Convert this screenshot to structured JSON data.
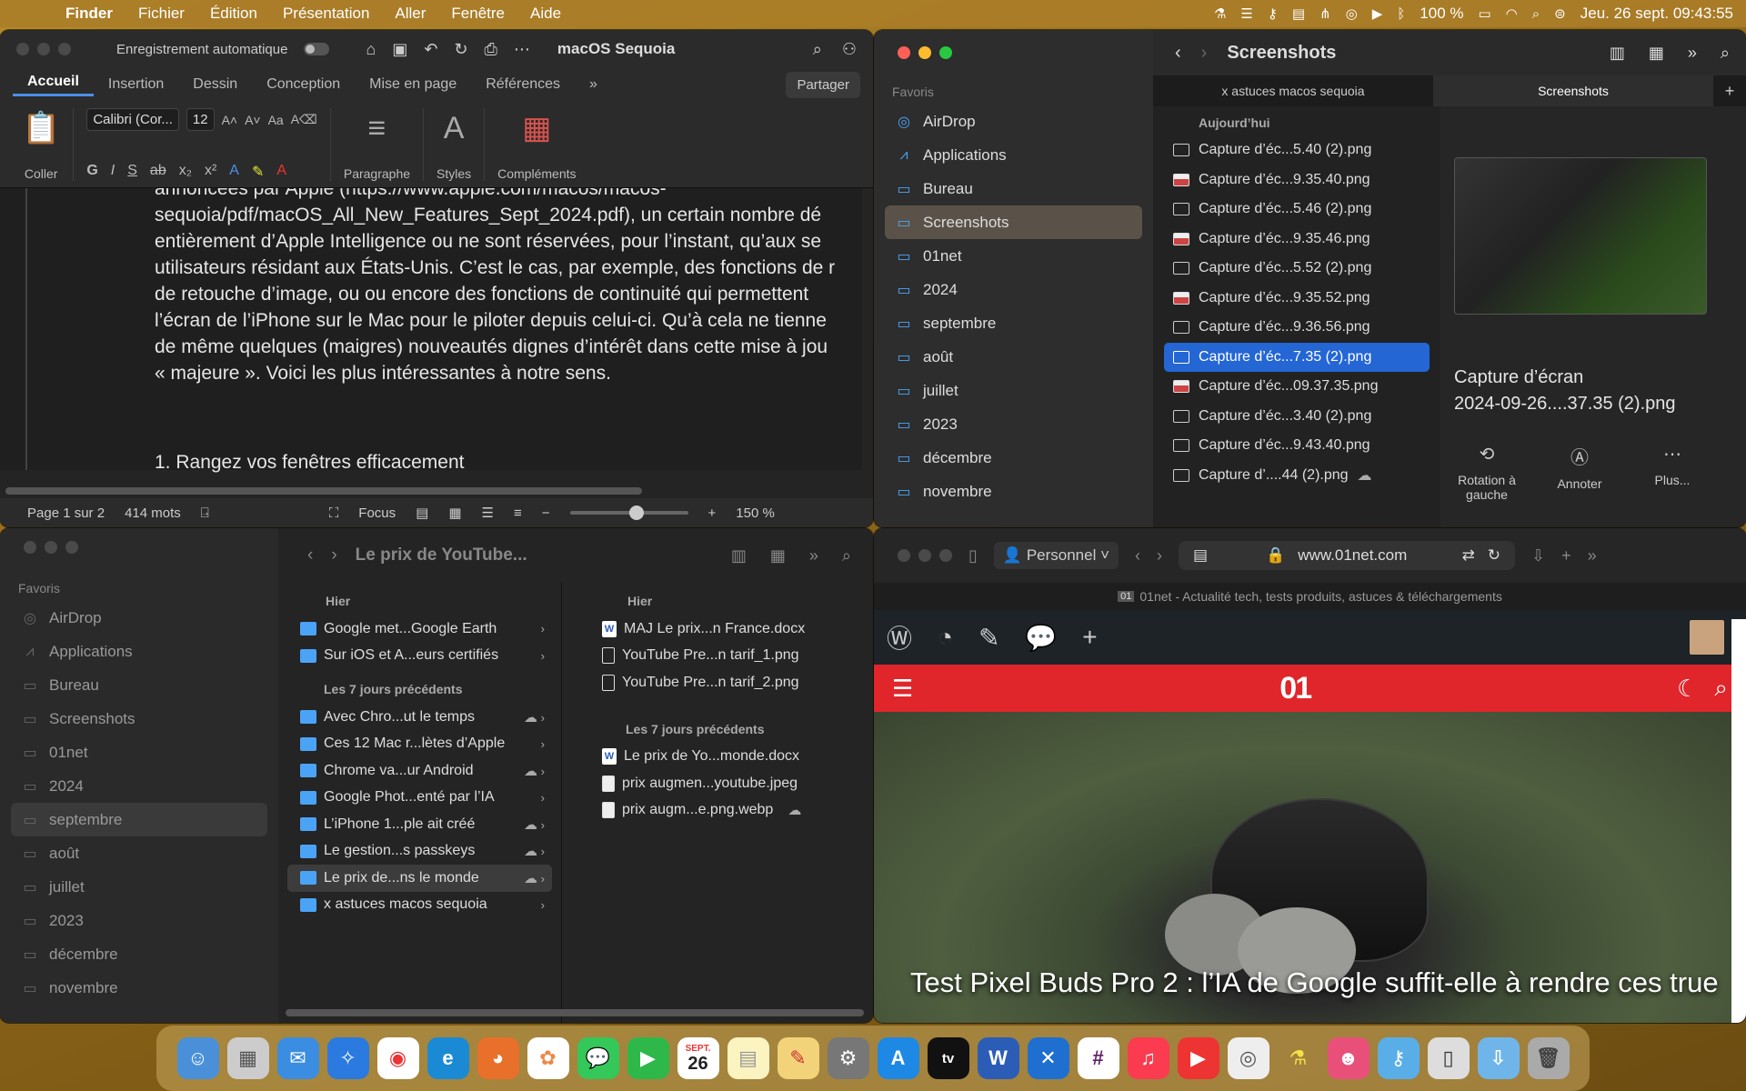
{
  "menubar": {
    "app": "Finder",
    "menus": [
      "Fichier",
      "Édition",
      "Présentation",
      "Aller",
      "Fenêtre",
      "Aide"
    ],
    "battery": "100 %",
    "datetime": "Jeu. 26 sept.  09:43:55"
  },
  "word": {
    "autosave": "Enregistrement automatique",
    "doc_title": "macOS Sequoia",
    "tabs": [
      "Accueil",
      "Insertion",
      "Dessin",
      "Conception",
      "Mise en page",
      "Références"
    ],
    "share": "Partager",
    "paste_label": "Coller",
    "font_name": "Calibri (Cor...",
    "font_size": "12",
    "paragraph_label": "Paragraphe",
    "styles_label": "Styles",
    "addins_label": "Compléments",
    "body_lines": [
      "annoncées par Apple (https://www.apple.com/macos/macos-",
      "sequoia/pdf/macOS_All_New_Features_Sept_2024.pdf), un certain nombre dé",
      "entièrement d’Apple Intelligence ou ne sont réservées, pour l’instant, qu’aux se",
      "utilisateurs résidant aux États-Unis. C’est le cas, par exemple, des fonctions de r",
      "de retouche d’image, ou ou encore des fonctions de continuité qui permettent",
      "l’écran de l’iPhone sur le Mac pour le piloter depuis celui-ci. Qu’à cela ne tienne",
      "de même quelques (maigres) nouveautés dignes d’intérêt dans cette mise à jou",
      "« majeure ». Voici les plus intéressantes à notre sens."
    ],
    "heading": "1. Rangez vos fenêtres efficacement",
    "status": {
      "page": "Page 1 sur 2",
      "words": "414 mots",
      "focus": "Focus",
      "zoom": "150 %"
    }
  },
  "finder_top": {
    "title": "Screenshots",
    "sidebar_section": "Favoris",
    "sidebar": [
      "AirDrop",
      "Applications",
      "Bureau",
      "Screenshots",
      "01net",
      "2024",
      "septembre",
      "août",
      "juillet",
      "2023",
      "décembre",
      "novembre"
    ],
    "tabs": [
      "x astuces macos sequoia",
      "Screenshots"
    ],
    "group": "Aujourd’hui",
    "files": [
      "Capture d’éc...5.40 (2).png",
      "Capture d’éc...9.35.40.png",
      "Capture d’éc...5.46 (2).png",
      "Capture d’éc...9.35.46.png",
      "Capture d’éc...5.52 (2).png",
      "Capture d’éc...9.35.52.png",
      "Capture d’éc...9.36.56.png",
      "Capture d’éc...7.35 (2).png",
      "Capture d’éc...09.37.35.png",
      "Capture d’éc...3.40 (2).png",
      "Capture d’éc...9.43.40.png",
      "Capture d’....44 (2).png"
    ],
    "preview_name_1": "Capture d’écran",
    "preview_name_2": "2024-09-26....37.35 (2).png",
    "actions": [
      "Rotation à gauche",
      "Annoter",
      "Plus..."
    ]
  },
  "finder_bottom": {
    "title": "Le prix de YouTube...",
    "sidebar_section": "Favoris",
    "sidebar": [
      "AirDrop",
      "Applications",
      "Bureau",
      "Screenshots",
      "01net",
      "2024",
      "septembre",
      "août",
      "juillet",
      "2023",
      "décembre",
      "novembre"
    ],
    "col1_group1": "Hier",
    "col1_items1": [
      "Google met...Google Earth",
      "Sur iOS et A...eurs certifiés"
    ],
    "col1_group2": "Les 7 jours précédents",
    "col1_items2": [
      "Avec Chro...ut le temps",
      "Ces 12 Mac r...lètes d’Apple",
      "Chrome va...ur Android",
      "Google Phot...enté par l’IA",
      "L’iPhone 1...ple ait créé",
      "Le gestion...s passkeys",
      "Le prix de...ns le monde",
      "x astuces macos sequoia"
    ],
    "col2_group1": "Hier",
    "col2_items1": [
      "MAJ Le prix...n France.docx",
      "YouTube Pre...n tarif_1.png",
      "YouTube Pre...n tarif_2.png"
    ],
    "col2_group2": "Les 7 jours précédents",
    "col2_items2": [
      "Le prix de Yo...monde.docx",
      "prix augmen...youtube.jpeg",
      "prix augm...e.png.webp"
    ]
  },
  "safari": {
    "profile": "Personnel",
    "url": "www.01net.com",
    "tab_title": "01net - Actualité tech, tests produits, astuces & téléchargements",
    "logo": "01",
    "headline": "Test Pixel Buds Pro 2 : l’IA de Google suffit-elle à rendre ces true"
  },
  "dock": {
    "calendar_month": "SEPT.",
    "calendar_day": "26"
  }
}
